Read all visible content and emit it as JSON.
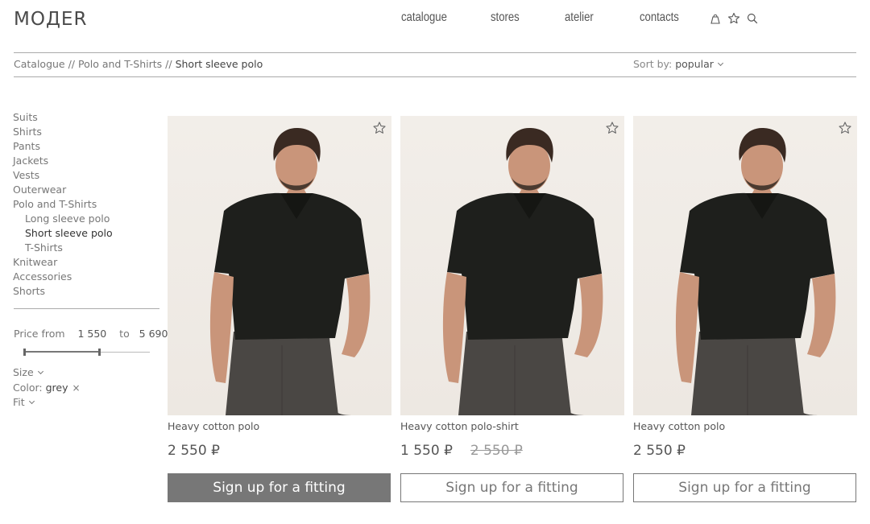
{
  "header": {
    "logo": "MOДЕR",
    "nav": [
      "catalogue",
      "stores",
      "atelier",
      "contacts"
    ],
    "icons": [
      "account-icon",
      "favorites-icon",
      "search-icon"
    ]
  },
  "breadcrumb": {
    "path": "Catalogue // Polo and T-Shirts // ",
    "current": "Short sleeve polo"
  },
  "sort": {
    "label": "Sort by: ",
    "value": "popular"
  },
  "sidebar": {
    "categories": [
      {
        "label": "Suits",
        "level": 0
      },
      {
        "label": "Shirts",
        "level": 0
      },
      {
        "label": "Pants",
        "level": 0
      },
      {
        "label": "Jackets",
        "level": 0
      },
      {
        "label": "Vests",
        "level": 0
      },
      {
        "label": "Outerwear",
        "level": 0
      },
      {
        "label": "Polo and T-Shirts",
        "level": 0
      },
      {
        "label": "Long sleeve polo",
        "level": 1
      },
      {
        "label": "Short sleeve polo",
        "level": 1,
        "active": true
      },
      {
        "label": "T-Shirts",
        "level": 1
      },
      {
        "label": "Knitwear",
        "level": 0
      },
      {
        "label": "Accessories",
        "level": 0
      },
      {
        "label": "Shorts",
        "level": 0
      }
    ],
    "price": {
      "from_label": "Price from",
      "min": "1 550",
      "to_label": "to",
      "max": "5 690"
    },
    "filters": {
      "size_label": "Size",
      "color_label": "Color:",
      "color_value": "grey",
      "remove_symbol": "×",
      "fit_label": "Fit"
    }
  },
  "products": [
    {
      "name": "Heavy cotton polo",
      "price": "2 550 ₽",
      "old_price": "",
      "button": "Sign up for a fitting",
      "button_style": "filled"
    },
    {
      "name": "Heavy cotton polo-shirt",
      "price": "1 550 ₽",
      "old_price": "2 550 ₽",
      "button": "Sign up for a fitting",
      "button_style": "outline"
    },
    {
      "name": "Heavy cotton polo",
      "price": "2 550 ₽",
      "old_price": "",
      "button": "Sign up for a fitting",
      "button_style": "outline"
    }
  ],
  "colors": {
    "text": "#555555",
    "rule": "#aaaaaa",
    "button_filled": "#777777",
    "shirt": "#1e1f1c",
    "pants": "#4a4744",
    "skin": "#c9957a",
    "hair": "#3a2a22",
    "photo_background": "#efeae4"
  }
}
